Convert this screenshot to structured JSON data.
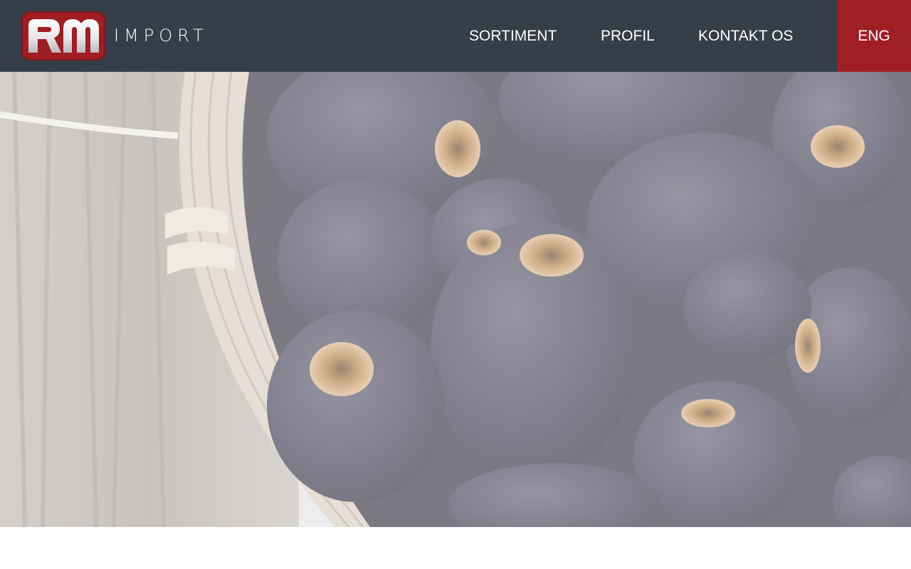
{
  "brand": {
    "badge_letters": "RM",
    "wordmark": "IMPORT",
    "colors": {
      "header_bg": "#353e49",
      "brand_red": "#a01f24",
      "text": "#ffffff"
    }
  },
  "nav": {
    "items": [
      {
        "label": "SORTIMENT"
      },
      {
        "label": "PROFIL"
      },
      {
        "label": "KONTAKT OS"
      }
    ],
    "language_label": "ENG"
  },
  "hero": {
    "image_subject": "dates-in-wicker-basket"
  }
}
